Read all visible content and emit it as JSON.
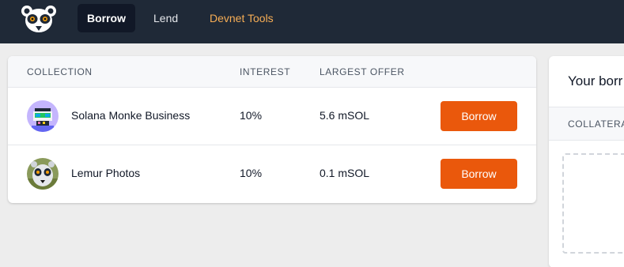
{
  "nav": {
    "logo_icon": "lemur-face-icon",
    "items": [
      {
        "label": "Borrow",
        "active": true
      },
      {
        "label": "Lend",
        "active": false
      },
      {
        "label": "Devnet Tools",
        "active": false,
        "accent": "#f6ad55"
      }
    ]
  },
  "collections": {
    "headers": {
      "collection": "COLLECTION",
      "interest": "INTEREST",
      "largest_offer": "LARGEST OFFER"
    },
    "rows": [
      {
        "name": "Solana Monke Business",
        "interest": "10%",
        "largest_offer": "5.6 mSOL",
        "action": "Borrow",
        "avatar_icon": "pixel-monke-avatar"
      },
      {
        "name": "Lemur Photos",
        "interest": "10%",
        "largest_offer": "0.1 mSOL",
        "action": "Borrow",
        "avatar_icon": "lemur-photo-avatar"
      }
    ]
  },
  "borrowings": {
    "title": "Your borr",
    "column": "COLLATERA"
  },
  "colors": {
    "topbar": "#1f2937",
    "accent_button": "#ea580c",
    "devnet_link": "#f6ad55"
  }
}
